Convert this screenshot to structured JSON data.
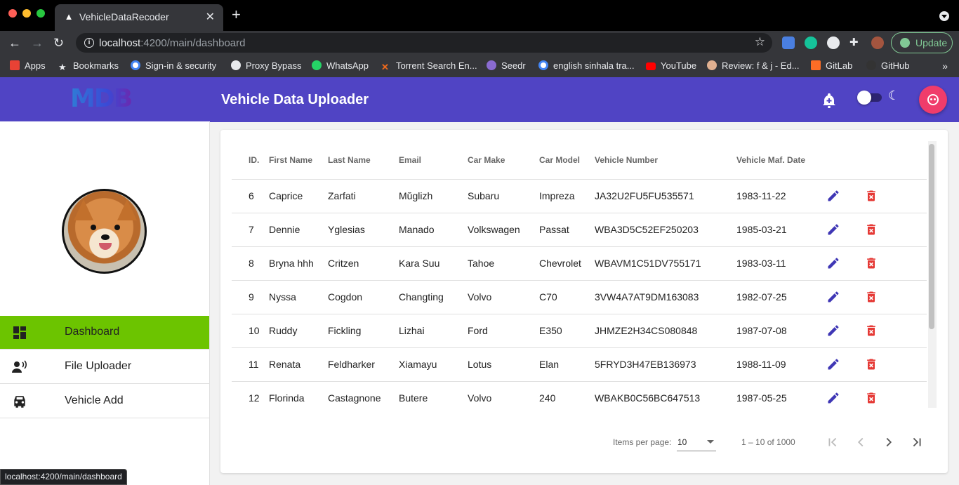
{
  "browser": {
    "tab_title": "VehicleDataRecoder",
    "url_host": "localhost",
    "url_path": ":4200/main/dashboard",
    "update_label": "Update",
    "status_url": "localhost:4200/main/dashboard",
    "bookmarks": [
      {
        "label": "Apps",
        "icon": "apps-grid-icon",
        "color": "#e94235"
      },
      {
        "label": "Bookmarks",
        "icon": "star-icon",
        "color": "#e8eaed"
      },
      {
        "label": "Sign-in & security",
        "icon": "google-icon",
        "color": "#4285f4"
      },
      {
        "label": "Proxy Bypass",
        "icon": "proxy-icon",
        "color": "#e8eaed"
      },
      {
        "label": "WhatsApp",
        "icon": "whatsapp-icon",
        "color": "#25d366"
      },
      {
        "label": "Torrent Search En...",
        "icon": "torrent-icon",
        "color": "#f06a1c"
      },
      {
        "label": "Seedr",
        "icon": "seedr-icon",
        "color": "#8a6bd1"
      },
      {
        "label": "english sinhala tra...",
        "icon": "google-icon",
        "color": "#4285f4"
      },
      {
        "label": "YouTube",
        "icon": "youtube-icon",
        "color": "#ff0000"
      },
      {
        "label": "Review: f & j - Ed...",
        "icon": "review-icon",
        "color": "#e0b090"
      },
      {
        "label": "GitLab",
        "icon": "gitlab-icon",
        "color": "#fc6d26"
      },
      {
        "label": "GitHub",
        "icon": "github-icon",
        "color": "#333333"
      }
    ],
    "bookmarks_more": "»"
  },
  "sidebar": {
    "logo": "MDB",
    "menu": [
      {
        "label": "Dashboard",
        "icon": "dashboard-icon",
        "active": true
      },
      {
        "label": "File Uploader",
        "icon": "record-voice-icon",
        "active": false
      },
      {
        "label": "Vehicle Add",
        "icon": "car-icon",
        "active": false
      }
    ]
  },
  "header": {
    "title": "Vehicle Data Uploader"
  },
  "table": {
    "columns": [
      "ID.",
      "First Name",
      "Last Name",
      "Email",
      "Car Make",
      "Car Model",
      "Vehicle Number",
      "Vehicle Maf. Date"
    ],
    "rows": [
      [
        "6",
        "Caprice",
        "Zarfati",
        "Mŭglizh",
        "Subaru",
        "Impreza",
        "JA32U2FU5FU535571",
        "1983-11-22"
      ],
      [
        "7",
        "Dennie",
        "Yglesias",
        "Manado",
        "Volkswagen",
        "Passat",
        "WBA3D5C52EF250203",
        "1985-03-21"
      ],
      [
        "8",
        "Bryna hhh",
        "Critzen",
        "Kara Suu",
        "Tahoe",
        "Chevrolet",
        "WBAVM1C51DV755171",
        "1983-03-11"
      ],
      [
        "9",
        "Nyssa",
        "Cogdon",
        "Changting",
        "Volvo",
        "C70",
        "3VW4A7AT9DM163083",
        "1982-07-25"
      ],
      [
        "10",
        "Ruddy",
        "Fickling",
        "Lizhai",
        "Ford",
        "E350",
        "JHMZE2H34CS080848",
        "1987-07-08"
      ],
      [
        "11",
        "Renata",
        "Feldharker",
        "Xiamayu",
        "Lotus",
        "Elan",
        "5FRYD3H47EB136973",
        "1988-11-09"
      ],
      [
        "12",
        "Florinda",
        "Castagnone",
        "Butere",
        "Volvo",
        "240",
        "WBAKB0C56BC647513",
        "1987-05-25"
      ]
    ]
  },
  "paginator": {
    "items_per_page_label": "Items per page:",
    "items_per_page_value": "10",
    "range_label": "1 – 10 of 1000"
  },
  "colors": {
    "primary": "#5044c4",
    "active_menu": "#6cc400",
    "edit_icon": "#3f37b5",
    "delete_icon": "#e53935",
    "fab": "#f03c6b"
  }
}
